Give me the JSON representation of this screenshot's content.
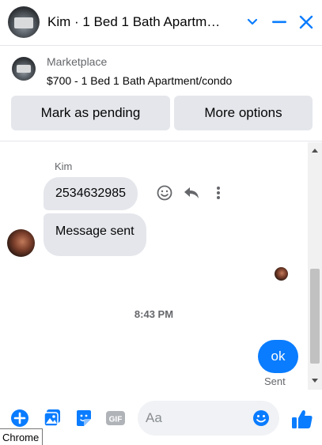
{
  "header": {
    "title": "Kim · 1 Bed 1 Bath Apartm…",
    "icons": [
      "chevron-down-icon",
      "minimize-icon",
      "close-icon"
    ]
  },
  "marketplace": {
    "label": "Marketplace",
    "listing": "$700 - 1 Bed 1 Bath Apartment/condo",
    "pending_button": "Mark as pending",
    "more_button": "More options"
  },
  "thread": {
    "sender": "Kim",
    "messages": [
      {
        "text": "2534632985"
      },
      {
        "text": "Message sent"
      }
    ],
    "timestamp": "8:43 PM",
    "outgoing": "ok",
    "status": "Sent"
  },
  "composer": {
    "placeholder": "Aa",
    "value": "",
    "icons": [
      "plus-icon",
      "photo-icon",
      "sticker-icon",
      "gif-icon",
      "emoji-icon",
      "like-icon"
    ],
    "gif_label": "GIF"
  },
  "tooltip": {
    "text": "Chrome"
  },
  "colors": {
    "accent": "#0a7cff",
    "bubble": "#e4e6eb",
    "muted": "#65676b"
  }
}
